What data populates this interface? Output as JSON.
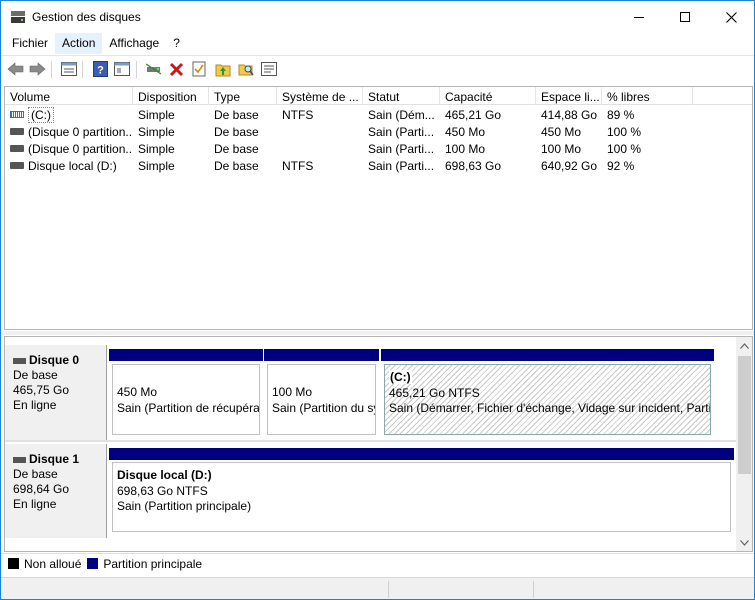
{
  "window": {
    "title": "Gestion des disques",
    "icon": "disk-management-icon"
  },
  "menu": [
    "Fichier",
    "Action",
    "Affichage",
    "?"
  ],
  "toolbar_icons": [
    "back-arrow-icon",
    "forward-arrow-icon",
    "properties-list-icon",
    "help-icon",
    "console-tree-icon",
    "connect-drive-icon",
    "delete-icon",
    "checklist-icon",
    "folder-up-icon",
    "search-folder-icon",
    "settings-window-icon"
  ],
  "list": {
    "columns": [
      "Volume",
      "Disposition",
      "Type",
      "Système de ...",
      "Statut",
      "Capacité",
      "Espace li...",
      "% libres"
    ],
    "rows": [
      [
        "(C:)",
        "Simple",
        "De base",
        "NTFS",
        "Sain (Dém...",
        "465,21 Go",
        "414,88 Go",
        "89 %"
      ],
      [
        "(Disque 0 partition...",
        "Simple",
        "De base",
        "",
        "Sain (Parti...",
        "450 Mo",
        "450 Mo",
        "100 %"
      ],
      [
        "(Disque 0 partition...",
        "Simple",
        "De base",
        "",
        "Sain (Parti...",
        "100 Mo",
        "100 Mo",
        "100 %"
      ],
      [
        "Disque local (D:)",
        "Simple",
        "De base",
        "NTFS",
        "Sain (Parti...",
        "698,63 Go",
        "640,92 Go",
        "92 %"
      ]
    ]
  },
  "disks": [
    {
      "name": "Disque 0",
      "type": "De base",
      "size": "465,75 Go",
      "status": "En ligne",
      "partitions": [
        {
          "title": "",
          "size": "450 Mo",
          "status": "Sain (Partition de récupéra"
        },
        {
          "title": "",
          "size": "100 Mo",
          "status": "Sain (Partition du sy"
        },
        {
          "title": "(C:)",
          "size": "465,21 Go NTFS",
          "status": "Sain (Démarrer, Fichier d'échange, Vidage sur incident, Partit"
        }
      ]
    },
    {
      "name": "Disque 1",
      "type": "De base",
      "size": "698,64 Go",
      "status": "En ligne",
      "partitions": [
        {
          "title": "Disque local  (D:)",
          "size": "698,63 Go NTFS",
          "status": "Sain (Partition principale)"
        }
      ]
    }
  ],
  "legend": {
    "unallocated": "Non alloué",
    "primary": "Partition principale",
    "unallocated_color": "#000000",
    "primary_color": "#00007f"
  }
}
